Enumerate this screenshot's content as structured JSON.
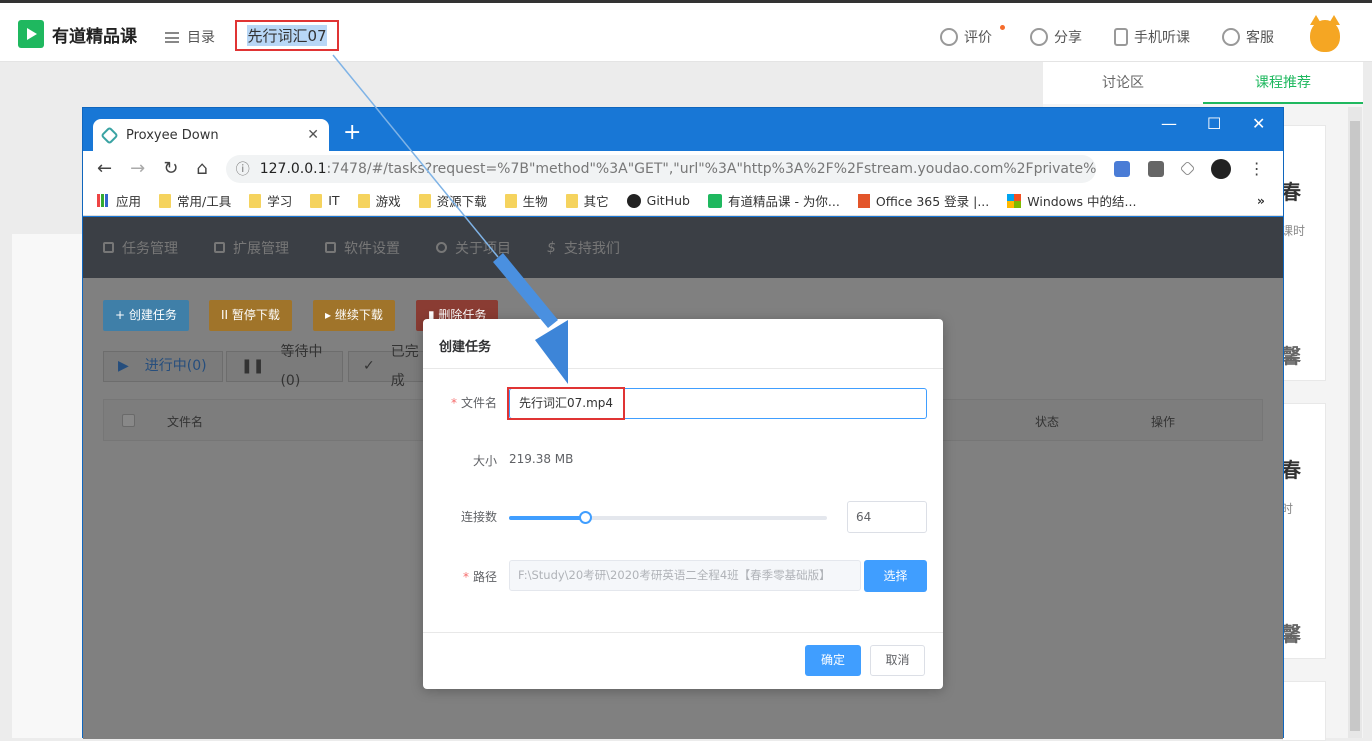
{
  "site": {
    "logo_text": "有道精品课",
    "menu_label": "目录",
    "course_title": "先行词汇07",
    "nav": {
      "rate": "评价",
      "share": "分享",
      "mobile": "手机听课",
      "service": "客服"
    },
    "right_tabs": [
      "讨论区",
      "课程推荐"
    ],
    "right_cards": [
      {
        "big": "春",
        "small": "课时",
        "bottom": "馨"
      },
      {
        "big": "春",
        "small": "时",
        "bottom": "馨"
      }
    ]
  },
  "browser": {
    "tab_title": "Proxyee Down",
    "new_tab": "+",
    "url_host": "127.0.0.1",
    "url_rest": ":7478/#/tasks?request=%7B\"method\"%3A\"GET\",\"url\"%3A\"http%3A%2F%2Fstream.youdao.com%2Fprivate%...",
    "bookmarks": [
      "应用",
      "常用/工具",
      "学习",
      "IT",
      "游戏",
      "资源下载",
      "生物",
      "其它",
      "GitHub",
      "有道精品课 - 为你...",
      "Office 365 登录 |...",
      "Windows 中的结..."
    ],
    "bookmarks_more": "»"
  },
  "app": {
    "nav": [
      "任务管理",
      "扩展管理",
      "软件设置",
      "关于项目",
      "支持我们"
    ],
    "buttons": {
      "create": "+ 创建任务",
      "pause": "II 暂停下载",
      "resume": "▸ 继续下载",
      "delete": "▮ 删除任务"
    },
    "status_tabs": [
      "进行中(0)",
      "等待中(0)",
      "已完成"
    ],
    "table_headers": {
      "filename": "文件名",
      "status": "状态",
      "action": "操作"
    }
  },
  "modal": {
    "title": "创建任务",
    "filename_label": "文件名",
    "filename_value": "先行词汇07.mp4",
    "size_label": "大小",
    "size_value": "219.38 MB",
    "connections_label": "连接数",
    "connections_value": "64",
    "connections_fraction": 0.24,
    "path_label": "路径",
    "path_value": "F:\\Study\\20考研\\2020考研英语二全程4班【春季零基础版】",
    "choose_button": "选择",
    "ok_button": "确定",
    "cancel_button": "取消"
  },
  "colors": {
    "brand_green": "#1fb85f",
    "chrome_blue": "#1877d6",
    "primary": "#409eff",
    "annotation_red": "#e03434"
  }
}
